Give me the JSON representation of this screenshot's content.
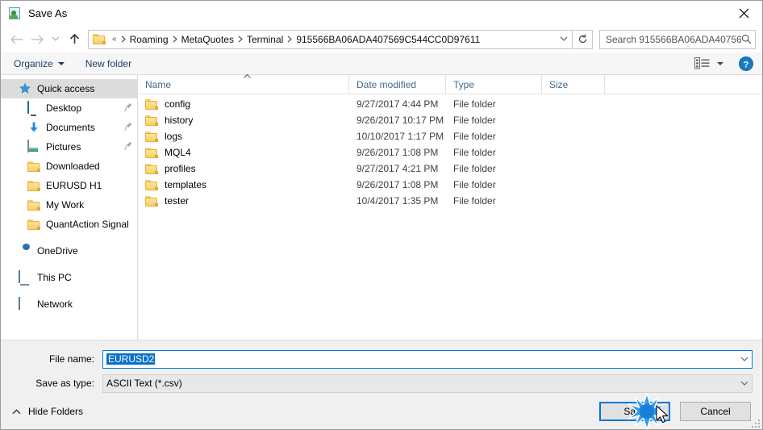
{
  "window": {
    "title": "Save As",
    "icon": "save-as-icon",
    "close_label": "×"
  },
  "nav": {
    "back_icon": "arrow-left-icon",
    "forward_icon": "arrow-right-icon",
    "recent_icon": "chevron-down-icon",
    "up_icon": "arrow-up-icon",
    "refresh_icon": "refresh-icon",
    "breadcrumb": [
      "«",
      "Roaming",
      "MetaQuotes",
      "Terminal",
      "915566BA06ADA407569C544CC0D97611"
    ],
    "address_dropdown_icon": "chevron-down-icon"
  },
  "search": {
    "placeholder": "Search 915566BA06ADA40756...",
    "value": "",
    "icon": "search-icon"
  },
  "toolbar": {
    "organize_label": "Organize",
    "new_folder_label": "New folder",
    "view_icon": "view-list-icon",
    "view_caret_icon": "chevron-down-icon",
    "help_icon": "help-icon",
    "help_label": "?"
  },
  "sidebar": {
    "items": [
      {
        "label": "Quick access",
        "icon": "star-icon",
        "level": 0,
        "selected": true,
        "pinned": false
      },
      {
        "label": "Desktop",
        "icon": "monitor-icon",
        "level": 1,
        "selected": false,
        "pinned": true
      },
      {
        "label": "Documents",
        "icon": "download-icon",
        "level": 1,
        "selected": false,
        "pinned": true
      },
      {
        "label": "Pictures",
        "icon": "picture-icon",
        "level": 1,
        "selected": false,
        "pinned": true
      },
      {
        "label": "Downloaded",
        "icon": "folder-icon",
        "level": 1,
        "selected": false,
        "pinned": false
      },
      {
        "label": "EURUSD H1",
        "icon": "folder-icon",
        "level": 1,
        "selected": false,
        "pinned": false
      },
      {
        "label": "My Work",
        "icon": "folder-icon",
        "level": 1,
        "selected": false,
        "pinned": false
      },
      {
        "label": "QuantAction Signal",
        "icon": "folder-icon",
        "level": 1,
        "selected": false,
        "pinned": false
      },
      {
        "label": "OneDrive",
        "icon": "onedrive-icon",
        "level": 0,
        "selected": false,
        "pinned": false,
        "gap_before": true
      },
      {
        "label": "This PC",
        "icon": "pc-icon",
        "level": 0,
        "selected": false,
        "pinned": false,
        "gap_before": true
      },
      {
        "label": "Network",
        "icon": "network-icon",
        "level": 0,
        "selected": false,
        "pinned": false,
        "gap_before": true
      }
    ]
  },
  "filelist": {
    "columns": [
      "Name",
      "Date modified",
      "Type",
      "Size"
    ],
    "sort_column": "Name",
    "sort_caret_icon": "caret-up-icon",
    "rows": [
      {
        "name": "config",
        "date": "9/27/2017 4:44 PM",
        "type": "File folder",
        "size": ""
      },
      {
        "name": "history",
        "date": "9/26/2017 10:17 PM",
        "type": "File folder",
        "size": ""
      },
      {
        "name": "logs",
        "date": "10/10/2017 1:17 PM",
        "type": "File folder",
        "size": ""
      },
      {
        "name": "MQL4",
        "date": "9/26/2017 1:08 PM",
        "type": "File folder",
        "size": ""
      },
      {
        "name": "profiles",
        "date": "9/27/2017 4:21 PM",
        "type": "File folder",
        "size": ""
      },
      {
        "name": "templates",
        "date": "9/26/2017 1:08 PM",
        "type": "File folder",
        "size": ""
      },
      {
        "name": "tester",
        "date": "10/4/2017 1:35 PM",
        "type": "File folder",
        "size": ""
      }
    ]
  },
  "form": {
    "filename_label": "File name:",
    "filename_value": "EURUSD2",
    "savetype_label": "Save as type:",
    "savetype_value": "ASCII Text (*.csv)",
    "dropdown_icon": "chevron-down-icon"
  },
  "footer": {
    "hide_folders_label": "Hide Folders",
    "hide_folders_icon": "chevron-up-icon",
    "save_label": "Save",
    "cancel_label": "Cancel",
    "resize_grip_icon": "resize-grip-icon"
  },
  "colors": {
    "accent": "#0078d7",
    "selection": "#0b6fc9",
    "sidebar_selected": "#dcdcdc",
    "header_text": "#43688e",
    "folder_yellow": "#f8cf66",
    "panel_bg": "#f0f0f0"
  },
  "overlay": {
    "click_effect_icon": "click-burst-icon",
    "cursor_icon": "mouse-pointer-icon"
  }
}
